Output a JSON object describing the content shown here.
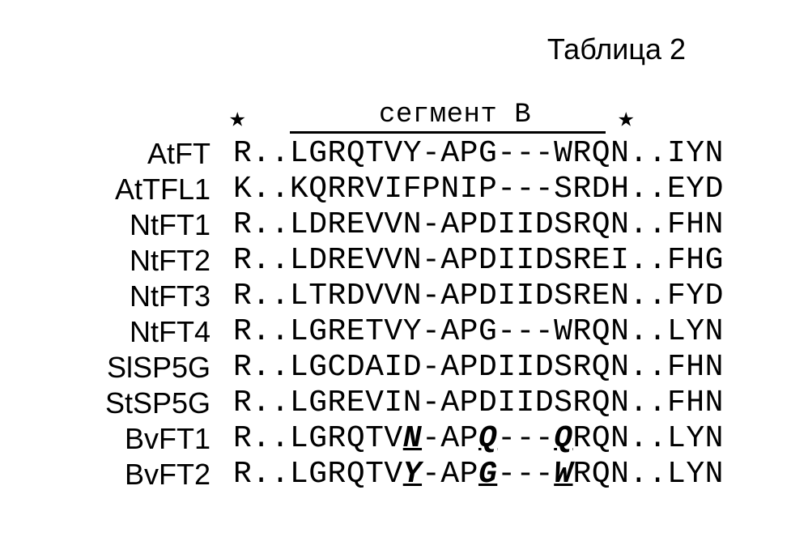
{
  "title": "Таблица 2",
  "segment_label": "сегмент B",
  "star": "★",
  "rows": [
    {
      "name": "AtFT",
      "seq": "R..LGRQTVY-APG---WRQN..IYN"
    },
    {
      "name": "AtTFL1",
      "seq": "K..KQRRVIFPNIP---SRDH..EYD"
    },
    {
      "name": "NtFT1",
      "seq": "R..LDREVVN-APDIIDSRQN..FHN"
    },
    {
      "name": "NtFT2",
      "seq": "R..LDREVVN-APDIIDSREI..FHG"
    },
    {
      "name": "NtFT3",
      "seq": "R..LTRDVVN-APDIIDSREN..FYD"
    },
    {
      "name": "NtFT4",
      "seq": "R..LGRETVY-APG---WRQN..LYN"
    },
    {
      "name": "SlSP5G",
      "seq": "R..LGCDAID-APDIIDSRQN..FHN"
    },
    {
      "name": "StSP5G",
      "seq": "R..LGREVIN-APDIIDSRQN..FHN"
    }
  ],
  "bvft1": {
    "name": "BvFT1",
    "parts": [
      "R..LGRQTV",
      "N",
      "-AP",
      "Q",
      "---",
      "Q",
      "RQN..LYN"
    ]
  },
  "bvft2": {
    "name": "BvFT2",
    "parts": [
      "R..LGRQTV",
      "Y",
      "-AP",
      "G",
      "---",
      "W",
      "RQN..LYN"
    ]
  }
}
